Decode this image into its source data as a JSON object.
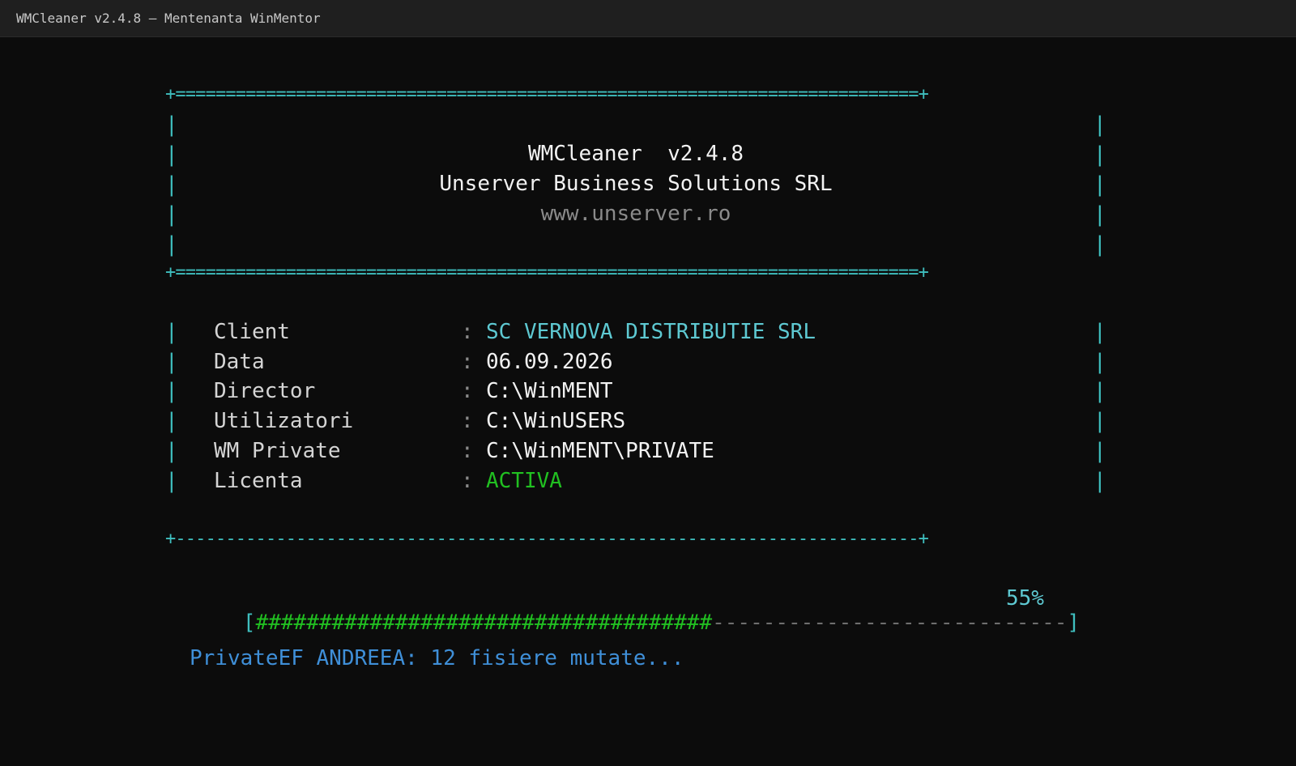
{
  "window": {
    "title": "WMCleaner v2.4.8 – Mentenanta WinMentor"
  },
  "banner": {
    "app_name": "WMCleaner  v2.4.8",
    "company": "Unserver Business Solutions SRL",
    "website": "www.unserver.ro"
  },
  "info": [
    {
      "label": "Client",
      "value": "SC VERNOVA DISTRIBUTIE SRL",
      "color": "#5ec9d2"
    },
    {
      "label": "Data",
      "value": "06.09.2026",
      "color": "#f2f2f2"
    },
    {
      "label": "Director",
      "value": "C:\\WinMENT",
      "color": "#f2f2f2"
    },
    {
      "label": "Utilizatori",
      "value": "C:\\WinUSERS",
      "color": "#f2f2f2"
    },
    {
      "label": "WM Private",
      "value": "C:\\WinMENT\\PRIVATE",
      "color": "#f2f2f2"
    },
    {
      "label": "Licenta",
      "value": "ACTIVA",
      "color": "#21c021"
    }
  ],
  "progress": {
    "fraction": 0.55,
    "percent_label": "55%"
  },
  "status": {
    "message": "PrivateEF ANDREEA: 12 fisiere mutate..."
  },
  "colors": {
    "border": "#3fbfbf",
    "accent_cyan": "#5ec9d2",
    "ok_green": "#21c021",
    "status_blue": "#3f8fd8",
    "background": "#0c0c0c"
  }
}
